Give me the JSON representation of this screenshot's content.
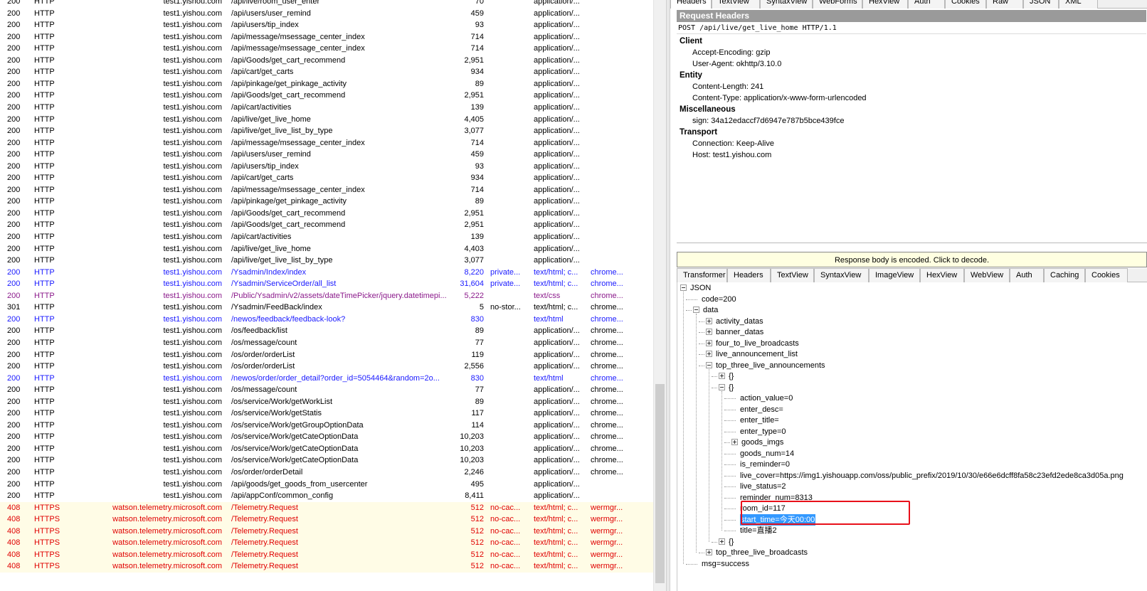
{
  "sessions": [
    {
      "result": "200",
      "protocol": "HTTP",
      "host": "test1.yishou.com",
      "url": "/api/live/room_user_enter",
      "body": "70",
      "caching": "",
      "content_type": "application/...",
      "process": "",
      "color": ""
    },
    {
      "result": "200",
      "protocol": "HTTP",
      "host": "test1.yishou.com",
      "url": "/api/users/user_remind",
      "body": "459",
      "caching": "",
      "content_type": "application/...",
      "process": "",
      "color": ""
    },
    {
      "result": "200",
      "protocol": "HTTP",
      "host": "test1.yishou.com",
      "url": "/api/users/tip_index",
      "body": "93",
      "caching": "",
      "content_type": "application/...",
      "process": "",
      "color": ""
    },
    {
      "result": "200",
      "protocol": "HTTP",
      "host": "test1.yishou.com",
      "url": "/api/message/msessage_center_index",
      "body": "714",
      "caching": "",
      "content_type": "application/...",
      "process": "",
      "color": ""
    },
    {
      "result": "200",
      "protocol": "HTTP",
      "host": "test1.yishou.com",
      "url": "/api/message/msessage_center_index",
      "body": "714",
      "caching": "",
      "content_type": "application/...",
      "process": "",
      "color": ""
    },
    {
      "result": "200",
      "protocol": "HTTP",
      "host": "test1.yishou.com",
      "url": "/api/Goods/get_cart_recommend",
      "body": "2,951",
      "caching": "",
      "content_type": "application/...",
      "process": "",
      "color": ""
    },
    {
      "result": "200",
      "protocol": "HTTP",
      "host": "test1.yishou.com",
      "url": "/api/cart/get_carts",
      "body": "934",
      "caching": "",
      "content_type": "application/...",
      "process": "",
      "color": ""
    },
    {
      "result": "200",
      "protocol": "HTTP",
      "host": "test1.yishou.com",
      "url": "/api/pinkage/get_pinkage_activity",
      "body": "89",
      "caching": "",
      "content_type": "application/...",
      "process": "",
      "color": ""
    },
    {
      "result": "200",
      "protocol": "HTTP",
      "host": "test1.yishou.com",
      "url": "/api/Goods/get_cart_recommend",
      "body": "2,951",
      "caching": "",
      "content_type": "application/...",
      "process": "",
      "color": ""
    },
    {
      "result": "200",
      "protocol": "HTTP",
      "host": "test1.yishou.com",
      "url": "/api/cart/activities",
      "body": "139",
      "caching": "",
      "content_type": "application/...",
      "process": "",
      "color": ""
    },
    {
      "result": "200",
      "protocol": "HTTP",
      "host": "test1.yishou.com",
      "url": "/api/live/get_live_home",
      "body": "4,405",
      "caching": "",
      "content_type": "application/...",
      "process": "",
      "color": ""
    },
    {
      "result": "200",
      "protocol": "HTTP",
      "host": "test1.yishou.com",
      "url": "/api/live/get_live_list_by_type",
      "body": "3,077",
      "caching": "",
      "content_type": "application/...",
      "process": "",
      "color": ""
    },
    {
      "result": "200",
      "protocol": "HTTP",
      "host": "test1.yishou.com",
      "url": "/api/message/msessage_center_index",
      "body": "714",
      "caching": "",
      "content_type": "application/...",
      "process": "",
      "color": ""
    },
    {
      "result": "200",
      "protocol": "HTTP",
      "host": "test1.yishou.com",
      "url": "/api/users/user_remind",
      "body": "459",
      "caching": "",
      "content_type": "application/...",
      "process": "",
      "color": ""
    },
    {
      "result": "200",
      "protocol": "HTTP",
      "host": "test1.yishou.com",
      "url": "/api/users/tip_index",
      "body": "93",
      "caching": "",
      "content_type": "application/...",
      "process": "",
      "color": ""
    },
    {
      "result": "200",
      "protocol": "HTTP",
      "host": "test1.yishou.com",
      "url": "/api/cart/get_carts",
      "body": "934",
      "caching": "",
      "content_type": "application/...",
      "process": "",
      "color": ""
    },
    {
      "result": "200",
      "protocol": "HTTP",
      "host": "test1.yishou.com",
      "url": "/api/message/msessage_center_index",
      "body": "714",
      "caching": "",
      "content_type": "application/...",
      "process": "",
      "color": ""
    },
    {
      "result": "200",
      "protocol": "HTTP",
      "host": "test1.yishou.com",
      "url": "/api/pinkage/get_pinkage_activity",
      "body": "89",
      "caching": "",
      "content_type": "application/...",
      "process": "",
      "color": ""
    },
    {
      "result": "200",
      "protocol": "HTTP",
      "host": "test1.yishou.com",
      "url": "/api/Goods/get_cart_recommend",
      "body": "2,951",
      "caching": "",
      "content_type": "application/...",
      "process": "",
      "color": ""
    },
    {
      "result": "200",
      "protocol": "HTTP",
      "host": "test1.yishou.com",
      "url": "/api/Goods/get_cart_recommend",
      "body": "2,951",
      "caching": "",
      "content_type": "application/...",
      "process": "",
      "color": ""
    },
    {
      "result": "200",
      "protocol": "HTTP",
      "host": "test1.yishou.com",
      "url": "/api/cart/activities",
      "body": "139",
      "caching": "",
      "content_type": "application/...",
      "process": "",
      "color": ""
    },
    {
      "result": "200",
      "protocol": "HTTP",
      "host": "test1.yishou.com",
      "url": "/api/live/get_live_home",
      "body": "4,403",
      "caching": "",
      "content_type": "application/...",
      "process": "",
      "color": ""
    },
    {
      "result": "200",
      "protocol": "HTTP",
      "host": "test1.yishou.com",
      "url": "/api/live/get_live_list_by_type",
      "body": "3,077",
      "caching": "",
      "content_type": "application/...",
      "process": "",
      "color": ""
    },
    {
      "result": "200",
      "protocol": "HTTP",
      "host": "test1.yishou.com",
      "url": "/Ysadmin/Index/index",
      "body": "8,220",
      "caching": "private...",
      "content_type": "text/html; c...",
      "process": "chrome...",
      "color": "blue"
    },
    {
      "result": "200",
      "protocol": "HTTP",
      "host": "test1.yishou.com",
      "url": "/Ysadmin/ServiceOrder/all_list",
      "body": "31,604",
      "caching": "private...",
      "content_type": "text/html; c...",
      "process": "chrome...",
      "color": "blue"
    },
    {
      "result": "200",
      "protocol": "HTTP",
      "host": "test1.yishou.com",
      "url": "/Public/Ysadmin/v2/assets/dateTimePicker/jquery.datetimepi...",
      "body": "5,222",
      "caching": "",
      "content_type": "text/css",
      "process": "chrome...",
      "color": "purple"
    },
    {
      "result": "301",
      "protocol": "HTTP",
      "host": "test1.yishou.com",
      "url": "/Ysadmin/FeedBack/index",
      "body": "5",
      "caching": "no-stor...",
      "content_type": "text/html; c...",
      "process": "chrome...",
      "color": ""
    },
    {
      "result": "200",
      "protocol": "HTTP",
      "host": "test1.yishou.com",
      "url": "/newos/feedback/feedback-look?",
      "body": "830",
      "caching": "",
      "content_type": "text/html",
      "process": "chrome...",
      "color": "blue"
    },
    {
      "result": "200",
      "protocol": "HTTP",
      "host": "test1.yishou.com",
      "url": "/os/feedback/list",
      "body": "89",
      "caching": "",
      "content_type": "application/...",
      "process": "chrome...",
      "color": ""
    },
    {
      "result": "200",
      "protocol": "HTTP",
      "host": "test1.yishou.com",
      "url": "/os/message/count",
      "body": "77",
      "caching": "",
      "content_type": "application/...",
      "process": "chrome...",
      "color": ""
    },
    {
      "result": "200",
      "protocol": "HTTP",
      "host": "test1.yishou.com",
      "url": "/os/order/orderList",
      "body": "119",
      "caching": "",
      "content_type": "application/...",
      "process": "chrome...",
      "color": ""
    },
    {
      "result": "200",
      "protocol": "HTTP",
      "host": "test1.yishou.com",
      "url": "/os/order/orderList",
      "body": "2,556",
      "caching": "",
      "content_type": "application/...",
      "process": "chrome...",
      "color": ""
    },
    {
      "result": "200",
      "protocol": "HTTP",
      "host": "test1.yishou.com",
      "url": "/newos/order/order_detail?order_id=5054464&random=2o...",
      "body": "830",
      "caching": "",
      "content_type": "text/html",
      "process": "chrome...",
      "color": "blue"
    },
    {
      "result": "200",
      "protocol": "HTTP",
      "host": "test1.yishou.com",
      "url": "/os/message/count",
      "body": "77",
      "caching": "",
      "content_type": "application/...",
      "process": "chrome...",
      "color": ""
    },
    {
      "result": "200",
      "protocol": "HTTP",
      "host": "test1.yishou.com",
      "url": "/os/service/Work/getWorkList",
      "body": "89",
      "caching": "",
      "content_type": "application/...",
      "process": "chrome...",
      "color": ""
    },
    {
      "result": "200",
      "protocol": "HTTP",
      "host": "test1.yishou.com",
      "url": "/os/service/Work/getStatis",
      "body": "117",
      "caching": "",
      "content_type": "application/...",
      "process": "chrome...",
      "color": ""
    },
    {
      "result": "200",
      "protocol": "HTTP",
      "host": "test1.yishou.com",
      "url": "/os/service/Work/getGroupOptionData",
      "body": "114",
      "caching": "",
      "content_type": "application/...",
      "process": "chrome...",
      "color": ""
    },
    {
      "result": "200",
      "protocol": "HTTP",
      "host": "test1.yishou.com",
      "url": "/os/service/Work/getCateOptionData",
      "body": "10,203",
      "caching": "",
      "content_type": "application/...",
      "process": "chrome...",
      "color": ""
    },
    {
      "result": "200",
      "protocol": "HTTP",
      "host": "test1.yishou.com",
      "url": "/os/service/Work/getCateOptionData",
      "body": "10,203",
      "caching": "",
      "content_type": "application/...",
      "process": "chrome...",
      "color": ""
    },
    {
      "result": "200",
      "protocol": "HTTP",
      "host": "test1.yishou.com",
      "url": "/os/service/Work/getCateOptionData",
      "body": "10,203",
      "caching": "",
      "content_type": "application/...",
      "process": "chrome...",
      "color": ""
    },
    {
      "result": "200",
      "protocol": "HTTP",
      "host": "test1.yishou.com",
      "url": "/os/order/orderDetail",
      "body": "2,246",
      "caching": "",
      "content_type": "application/...",
      "process": "chrome...",
      "color": ""
    },
    {
      "result": "200",
      "protocol": "HTTP",
      "host": "test1.yishou.com",
      "url": "/api/goods/get_goods_from_usercenter",
      "body": "495",
      "caching": "",
      "content_type": "application/...",
      "process": "",
      "color": ""
    },
    {
      "result": "200",
      "protocol": "HTTP",
      "host": "test1.yishou.com",
      "url": "/api/appConf/common_config",
      "body": "8,411",
      "caching": "",
      "content_type": "application/...",
      "process": "",
      "color": ""
    },
    {
      "result": "408",
      "protocol": "HTTPS",
      "host": "watson.telemetry.microsoft.com",
      "url": "/Telemetry.Request",
      "body": "512",
      "caching": "no-cac...",
      "content_type": "text/html; c...",
      "process": "wermgr...",
      "color": "error"
    },
    {
      "result": "408",
      "protocol": "HTTPS",
      "host": "watson.telemetry.microsoft.com",
      "url": "/Telemetry.Request",
      "body": "512",
      "caching": "no-cac...",
      "content_type": "text/html; c...",
      "process": "wermgr...",
      "color": "error"
    },
    {
      "result": "408",
      "protocol": "HTTPS",
      "host": "watson.telemetry.microsoft.com",
      "url": "/Telemetry.Request",
      "body": "512",
      "caching": "no-cac...",
      "content_type": "text/html; c...",
      "process": "wermgr...",
      "color": "error"
    },
    {
      "result": "408",
      "protocol": "HTTPS",
      "host": "watson.telemetry.microsoft.com",
      "url": "/Telemetry.Request",
      "body": "512",
      "caching": "no-cac...",
      "content_type": "text/html; c...",
      "process": "wermgr...",
      "color": "error"
    },
    {
      "result": "408",
      "protocol": "HTTPS",
      "host": "watson.telemetry.microsoft.com",
      "url": "/Telemetry.Request",
      "body": "512",
      "caching": "no-cac...",
      "content_type": "text/html; c...",
      "process": "wermgr...",
      "color": "error"
    },
    {
      "result": "408",
      "protocol": "HTTPS",
      "host": "watson.telemetry.microsoft.com",
      "url": "/Telemetry.Request",
      "body": "512",
      "caching": "no-cac...",
      "content_type": "text/html; c...",
      "process": "wermgr...",
      "color": "error"
    }
  ],
  "request_tabs": [
    "Headers",
    "TextView",
    "SyntaxView",
    "WebForms",
    "HexView",
    "Auth",
    "Cookies",
    "Raw",
    "JSON",
    "XML"
  ],
  "request": {
    "title": "Request Headers",
    "line": "POST /api/live/get_live_home HTTP/1.1",
    "groups": [
      {
        "name": "Client",
        "items": [
          "Accept-Encoding: gzip",
          "User-Agent: okhttp/3.10.0"
        ]
      },
      {
        "name": "Entity",
        "items": [
          "Content-Length: 241",
          "Content-Type: application/x-www-form-urlencoded"
        ]
      },
      {
        "name": "Miscellaneous",
        "items": [
          "sign: 34a12edaccf7d6947e787b5bce439fce"
        ]
      },
      {
        "name": "Transport",
        "items": [
          "Connection: Keep-Alive",
          "Host: test1.yishou.com"
        ]
      }
    ]
  },
  "decode_bar": "Response body is encoded. Click to decode.",
  "response_tabs": [
    "Transformer",
    "Headers",
    "TextView",
    "SyntaxView",
    "ImageView",
    "HexView",
    "WebView",
    "Auth",
    "Caching",
    "Cookies"
  ],
  "json_tree": [
    {
      "text": "JSON",
      "level": 0,
      "exp": "minus"
    },
    {
      "text": "code=200",
      "level": 1,
      "exp": ""
    },
    {
      "text": "data",
      "level": 1,
      "exp": "minus"
    },
    {
      "text": "activity_datas",
      "level": 2,
      "exp": "plus"
    },
    {
      "text": "banner_datas",
      "level": 2,
      "exp": "plus"
    },
    {
      "text": "four_to_live_broadcasts",
      "level": 2,
      "exp": "plus"
    },
    {
      "text": "live_announcement_list",
      "level": 2,
      "exp": "plus"
    },
    {
      "text": "top_three_live_announcements",
      "level": 2,
      "exp": "minus"
    },
    {
      "text": "{}",
      "level": 3,
      "exp": "plus"
    },
    {
      "text": "{}",
      "level": 3,
      "exp": "minus"
    },
    {
      "text": "action_value=0",
      "level": 4,
      "exp": ""
    },
    {
      "text": "enter_desc=",
      "level": 4,
      "exp": ""
    },
    {
      "text": "enter_title=",
      "level": 4,
      "exp": ""
    },
    {
      "text": "enter_type=0",
      "level": 4,
      "exp": ""
    },
    {
      "text": "goods_imgs",
      "level": 4,
      "exp": "plus"
    },
    {
      "text": "goods_num=14",
      "level": 4,
      "exp": ""
    },
    {
      "text": "is_reminder=0",
      "level": 4,
      "exp": ""
    },
    {
      "text": "live_cover=https://img1.yishouapp.com/oss/public_prefix/2019/10/30/e66e6dcff8fa58c23efd2ede8ca3d05a.png",
      "level": 4,
      "exp": ""
    },
    {
      "text": "live_status=2",
      "level": 4,
      "exp": ""
    },
    {
      "text": "reminder_num=8313",
      "level": 4,
      "exp": ""
    },
    {
      "text": "room_id=117",
      "level": 4,
      "exp": ""
    },
    {
      "text": "start_time=今天00:00",
      "level": 4,
      "exp": "",
      "selected": true
    },
    {
      "text": "title=直播2",
      "level": 4,
      "exp": ""
    },
    {
      "text": "{}",
      "level": 3,
      "exp": "plus"
    },
    {
      "text": "top_three_live_broadcasts",
      "level": 2,
      "exp": "plus"
    },
    {
      "text": "msg=success",
      "level": 1,
      "exp": ""
    }
  ]
}
